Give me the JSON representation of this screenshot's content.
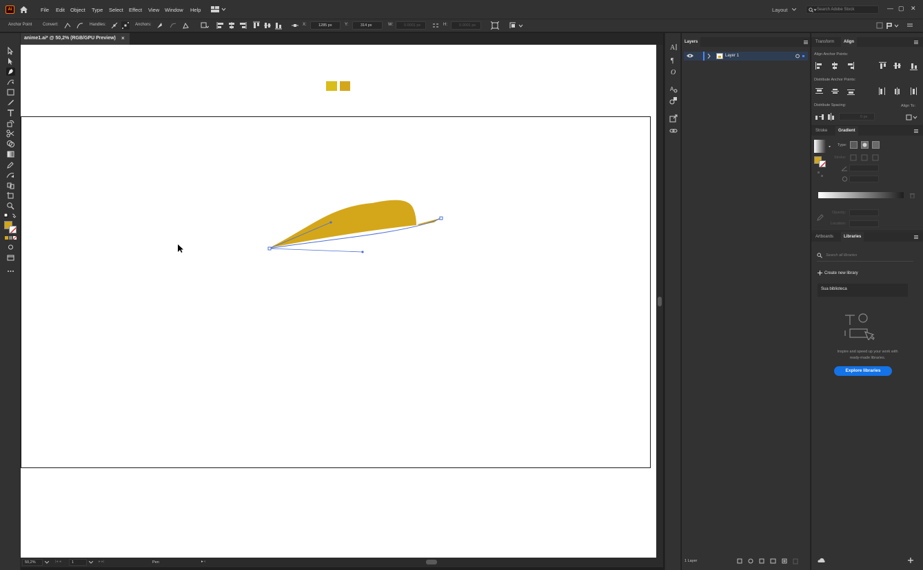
{
  "app": {
    "logo": "Ai",
    "menu": [
      "File",
      "Edit",
      "Object",
      "Type",
      "Select",
      "Effect",
      "View",
      "Window",
      "Help"
    ],
    "workspace": "Layout",
    "search_placeholder": "Search Adobe Stock"
  },
  "control_bar": {
    "tool_name": "Anchor Point",
    "convert_label": "Convert:",
    "handles_label": "Handles:",
    "anchors_label": "Anchors:",
    "x_label": "X:",
    "x_value": "1285 px",
    "y_label": "Y:",
    "y_value": "314 px",
    "w_label": "W:",
    "w_value": "0.0001 px",
    "h_label": "H:",
    "h_value": "0.0001 px"
  },
  "document": {
    "tab_title": "anime1.ai* @ 50,2% (RGB/GPU Preview)",
    "close_glyph": "×"
  },
  "status_bar": {
    "zoom": "50,2%",
    "artboard_number": "1",
    "tool_status": "Pen"
  },
  "layers_panel": {
    "tab": "Layers",
    "layer_name": "Layer 1",
    "footer_count": "1 Layer"
  },
  "transform_align": {
    "tabs": [
      "Transform",
      "Align"
    ],
    "align_anchor_points": "Align Anchor Points:",
    "distribute_anchor_points": "Distribute Anchor Points:",
    "distribute_spacing": "Distribute Spacing:",
    "spacing_value": "0 px",
    "align_to": "Align To:"
  },
  "stroke_gradient": {
    "tabs": [
      "Stroke",
      "Gradient"
    ],
    "type_label": "Type:",
    "stroke_label": "Stroke:",
    "opacity_label": "Opacity:",
    "location_label": "Location:"
  },
  "libraries": {
    "tabs": [
      "Artboards",
      "Libraries"
    ],
    "search_placeholder": "Search all libraries",
    "create_label": "Create new library",
    "library_item": "Sua biblioteca",
    "promo_text_1": "Inspire and speed up your work with",
    "promo_text_2": "ready-made libraries.",
    "explore_button": "Explore libraries"
  },
  "colors": {
    "fill_swatch": "#d4a71a",
    "swatch_light": "#d9bd1a",
    "swatch_dark": "#d4a71a",
    "shape_fill": "#d4a71a",
    "path_stroke": "#4a6fd6",
    "accent_blue": "#1473e6"
  },
  "icons": {
    "home": "home-icon",
    "search": "search-icon",
    "eye": "eye-icon",
    "plus": "plus-icon"
  }
}
